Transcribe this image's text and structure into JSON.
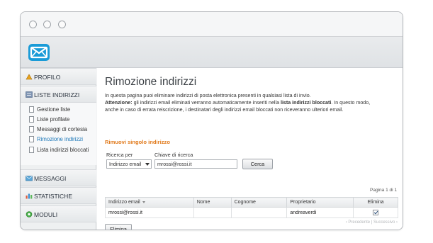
{
  "sidebar": {
    "profilo": "PROFILO",
    "liste_indirizzi": "LISTE INDIRIZZI",
    "items": [
      {
        "label": "Gestione liste"
      },
      {
        "label": "Liste profilate"
      },
      {
        "label": "Messaggi di cortesia"
      },
      {
        "label": "Rimozione indirizzi"
      },
      {
        "label": "Lista indirizzi bloccati"
      }
    ],
    "messaggi": "MESSAGGI",
    "statistiche": "STATISTICHE",
    "moduli": "MODULI"
  },
  "main": {
    "title": "Rimozione indirizzi",
    "intro_line1": "In questa pagina puoi eliminare indirizzi di posta elettronica presenti in qualsiasi lista di invio.",
    "attenzione_label": "Attenzione:",
    "intro_line2a": " gli indirizzi email eliminati verranno automaticamente inseriti nella ",
    "intro_bold": "lista indirizzi bloccati",
    "intro_line2b": ". In questo modo,",
    "intro_line3": "anche in caso di errata reiscrizione, i destinatari degli indirizzi email bloccati non riceveranno ulteriori email.",
    "section_title": "Rimuovi singolo indirizzo",
    "search_by_label": "Ricerca per",
    "search_by_value": "Indirizzo email",
    "search_key_label": "Chiave di ricerca",
    "search_key_value": "mrossi@rossi.it",
    "search_button": "Cerca",
    "page_info": "Pagina 1 di 1",
    "table": {
      "headers": [
        "Indirizzo email",
        "Nome",
        "Cognome",
        "Proprietario",
        "Elimina"
      ],
      "rows": [
        {
          "email": "mrossi@rossi.it",
          "nome": "",
          "cognome": "",
          "proprietario": "andreaverdi",
          "elimina": true
        }
      ]
    },
    "prev": "‹ Precedente",
    "next": "Successivo ›",
    "delete_button": "Elimina"
  },
  "colors": {
    "accent": "#e17a1c",
    "active_link": "#1e78b8",
    "logo": "#1a9bd7"
  }
}
